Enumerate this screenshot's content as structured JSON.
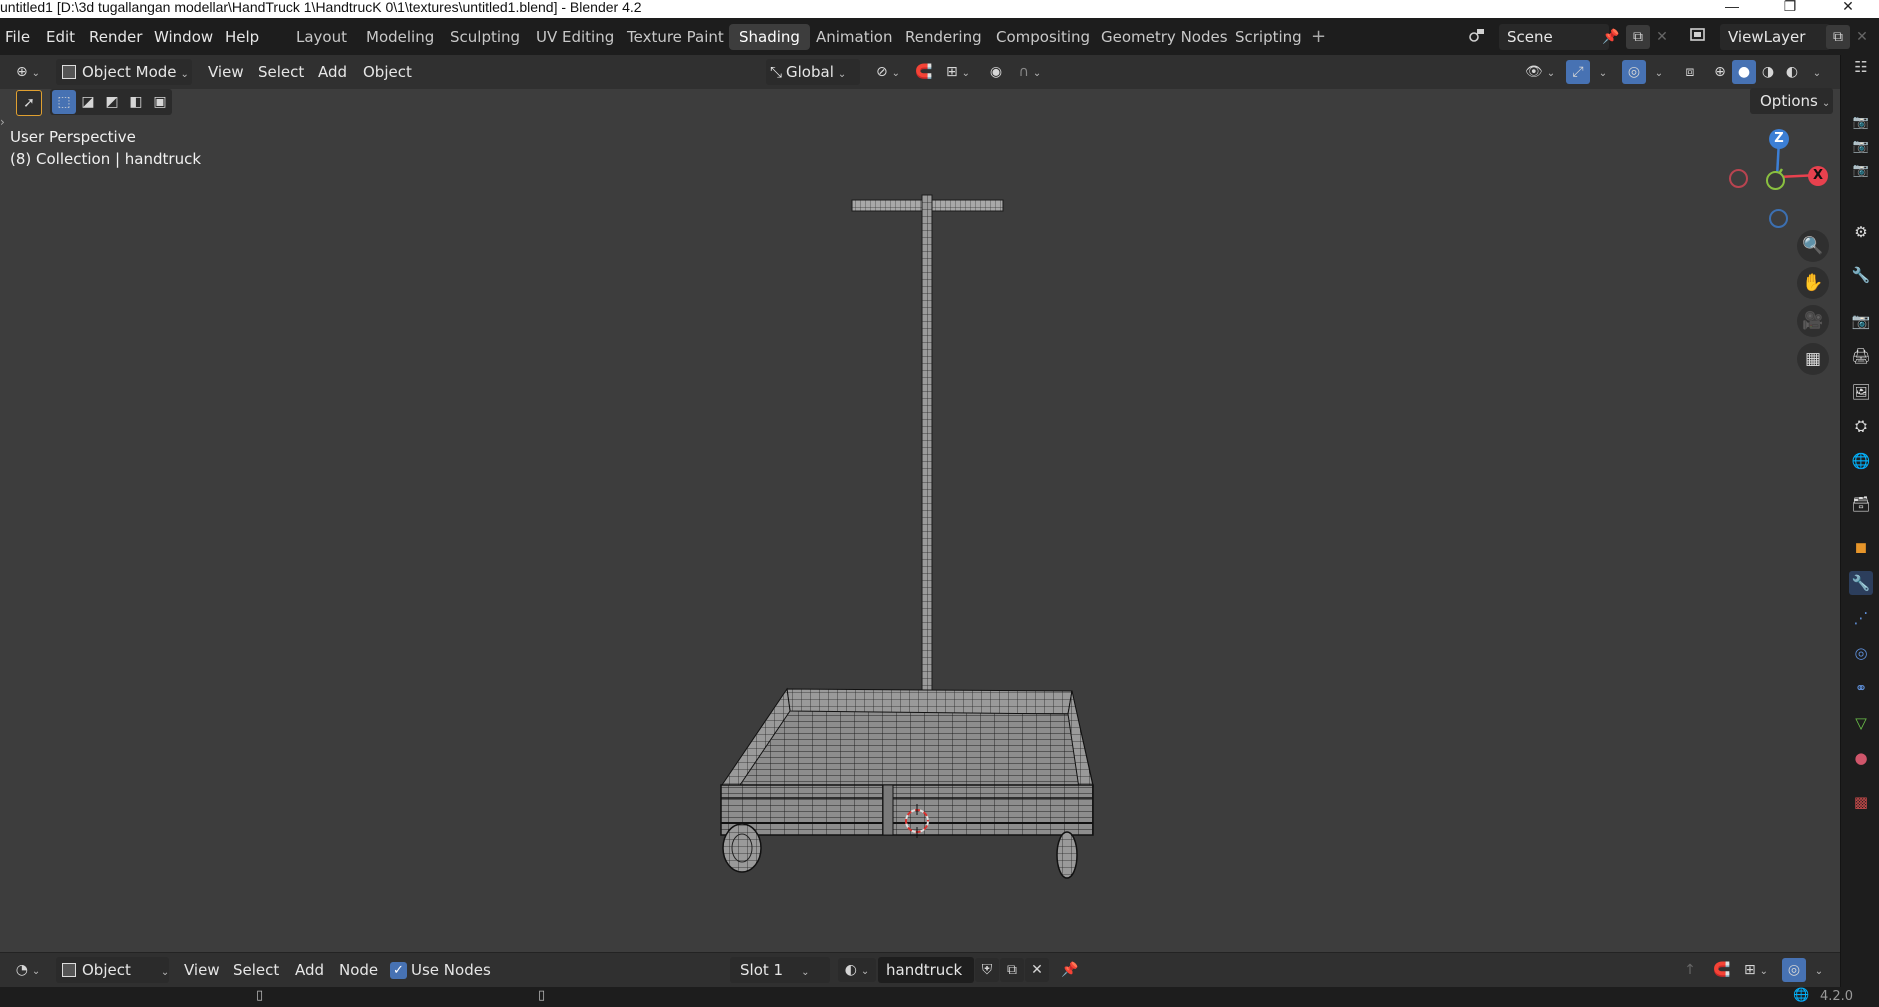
{
  "window": {
    "title": "untitled1 [D:\\3d tugallangan modellar\\HandTruck 1\\HandtrucK 0\\1\\textures\\untitled1.blend] - Blender 4.2",
    "minimize": "—",
    "maximize": "❐",
    "close": "✕"
  },
  "menu": {
    "file": "File",
    "edit": "Edit",
    "render": "Render",
    "window": "Window",
    "help": "Help"
  },
  "workspaces": [
    "Layout",
    "Modeling",
    "Sculpting",
    "UV Editing",
    "Texture Paint",
    "Shading",
    "Animation",
    "Rendering",
    "Compositing",
    "Geometry Nodes",
    "Scripting"
  ],
  "active_workspace": "Shading",
  "add_workspace": "+",
  "scene": {
    "name": "Scene"
  },
  "view_layer": {
    "name": "ViewLayer"
  },
  "viewport_header": {
    "mode": "Object Mode",
    "view": "View",
    "select": "Select",
    "add": "Add",
    "object": "Object",
    "transform_orientation": "Global",
    "options": "Options"
  },
  "viewport": {
    "perspective": "User Perspective",
    "collection_info": "(8) Collection | handtruck",
    "gizmo": {
      "z": "Z",
      "x": "X"
    }
  },
  "node_header": {
    "editor_mode": "Object",
    "view": "View",
    "select": "Select",
    "add": "Add",
    "node": "Node",
    "use_nodes_label": "Use Nodes",
    "use_nodes_checked": true,
    "slot": "Slot 1",
    "material": "handtruck"
  },
  "status": {
    "version": "4.2.0"
  },
  "colors": {
    "accent_blue": "#4772b3",
    "axis_x": "#e8414e",
    "axis_y": "#8ac040",
    "axis_z": "#3c7fd5"
  }
}
